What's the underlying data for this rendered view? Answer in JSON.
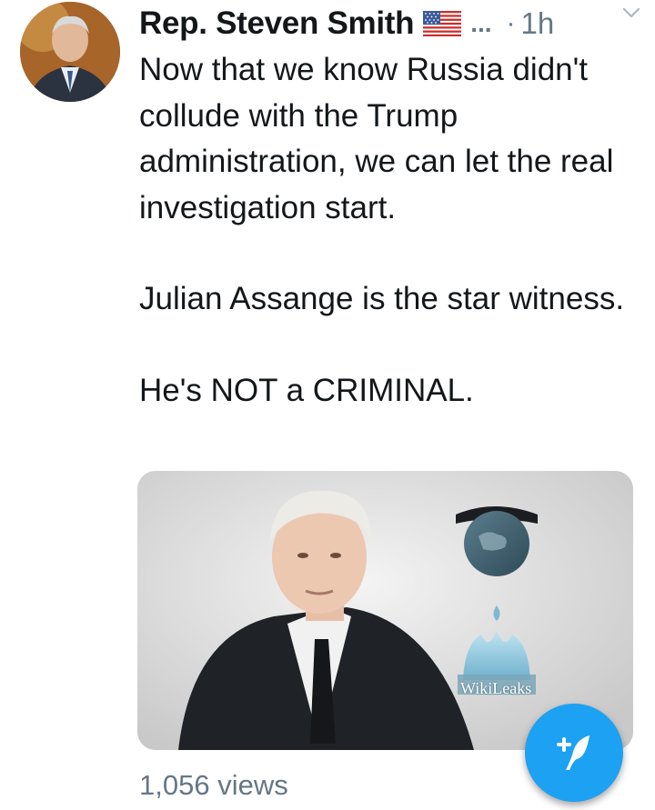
{
  "tweet": {
    "author_name": "Rep. Steven Smith",
    "flag_icon": "us-flag-icon",
    "ellipsis": "...",
    "separator": "·",
    "timestamp": "1h",
    "paragraphs": [
      "Now that we know Russia didn't collude with the Trump administration, we can let the real investigation start.",
      "Julian Assange is the star witness.",
      "He's NOT a CRIMINAL."
    ],
    "media": {
      "logo_text": "WikiLeaks"
    },
    "views": "1,056 views"
  },
  "compose_button": {
    "icon": "compose-tweet-icon",
    "color": "#1da1f2"
  },
  "colors": {
    "text_primary": "#14171a",
    "text_secondary": "#657786",
    "accent": "#1da1f2"
  }
}
